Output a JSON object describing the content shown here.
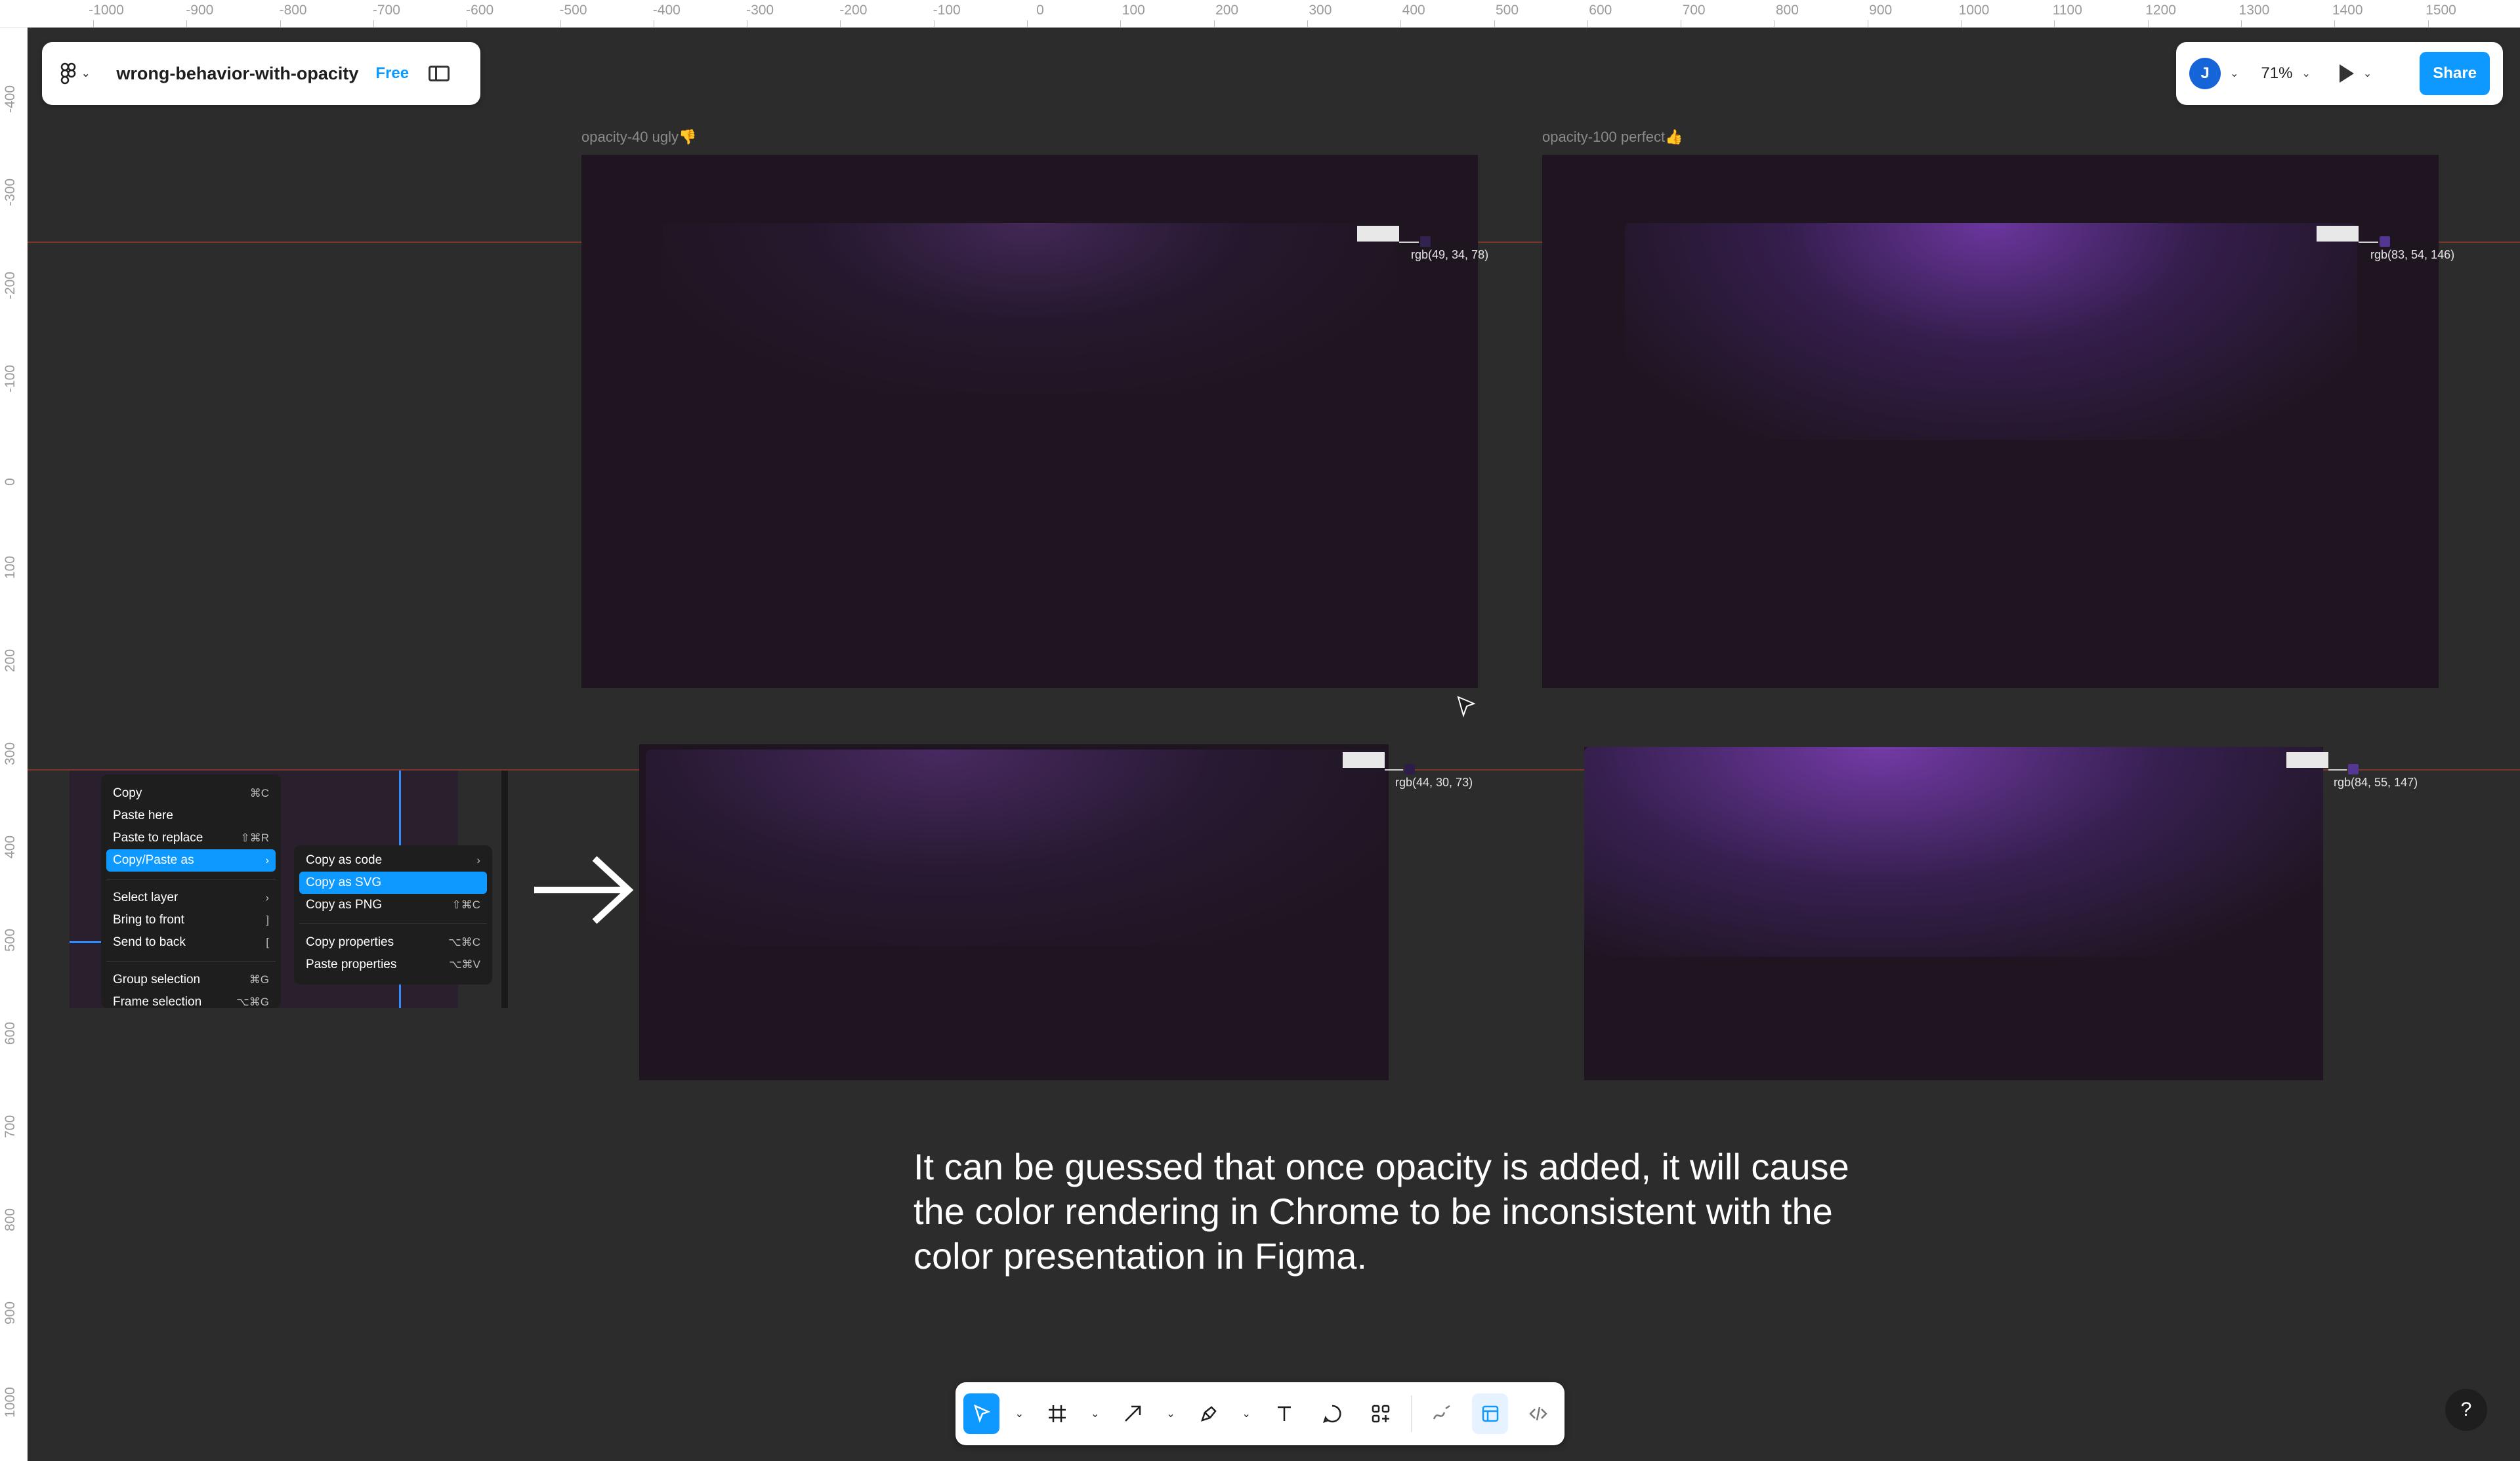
{
  "ruler": {
    "top_ticks": [
      "-1000",
      "-900",
      "-800",
      "-700",
      "-600",
      "-500",
      "-400",
      "-300",
      "-200",
      "-100",
      "0",
      "100",
      "200",
      "300",
      "400",
      "500",
      "600",
      "700",
      "800",
      "900",
      "1000",
      "1100",
      "1200",
      "1300",
      "1400",
      "1500"
    ],
    "left_ticks": [
      "-400",
      "-300",
      "-200",
      "-100",
      "0",
      "100",
      "200",
      "300",
      "400",
      "500",
      "600",
      "700",
      "800",
      "900",
      "1000"
    ]
  },
  "file_bar": {
    "file_name": "wrong-behavior-with-opacity",
    "plan": "Free"
  },
  "right_bar": {
    "avatar_initial": "J",
    "zoom": "71%",
    "share_label": "Share"
  },
  "frames": {
    "opacity40_label": "opacity-40 ugly👎",
    "opacity100_label": "opacity-100 perfect👍",
    "readout_1": "rgb(49, 34, 78)",
    "readout_2": "rgb(83, 54, 146)",
    "readout_3": "rgb(44, 30, 73)",
    "readout_4": "rgb(84, 55, 147)"
  },
  "context_menu": {
    "items": [
      {
        "label": "Copy",
        "shortcut": "⌘C"
      },
      {
        "label": "Paste here",
        "shortcut": ""
      },
      {
        "label": "Paste to replace",
        "shortcut": "⇧⌘R"
      },
      {
        "label": "Copy/Paste as",
        "shortcut": "›"
      },
      {
        "label": "Select layer",
        "shortcut": "›"
      },
      {
        "label": "Bring to front",
        "shortcut": "]"
      },
      {
        "label": "Send to back",
        "shortcut": "["
      },
      {
        "label": "Group selection",
        "shortcut": "⌘G"
      },
      {
        "label": "Frame selection",
        "shortcut": "⌥⌘G"
      }
    ],
    "submenu": [
      {
        "label": "Copy as code",
        "shortcut": "›"
      },
      {
        "label": "Copy as SVG",
        "shortcut": ""
      },
      {
        "label": "Copy as PNG",
        "shortcut": "⇧⌘C"
      },
      {
        "label": "Copy properties",
        "shortcut": "⌥⌘C"
      },
      {
        "label": "Paste properties",
        "shortcut": "⌥⌘V"
      }
    ]
  },
  "caption": "It can be guessed that once opacity is added, it will cause the color rendering in Chrome to be inconsistent with the color presentation in Figma.",
  "bottom_toolbar": {
    "tools": [
      "move-tool",
      "frame-tool",
      "shape-tool",
      "pen-tool",
      "text-tool",
      "comment-tool",
      "actions-tool",
      "draw-mode",
      "design-mode",
      "dev-mode"
    ]
  },
  "help_label": "?",
  "colors": {
    "accent": "#0d99ff",
    "frame_bg": "#1e1520",
    "canvas_bg": "#2c2c2c"
  }
}
